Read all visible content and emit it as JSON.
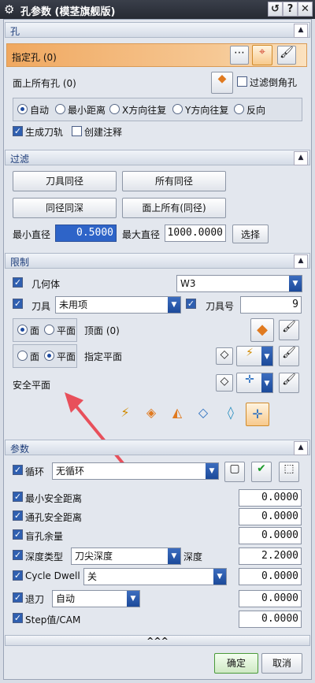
{
  "window": {
    "title": "孔参数 (模茎旗舰版)"
  },
  "sections": {
    "hole": {
      "title": "孔"
    },
    "filter": {
      "title": "过滤"
    },
    "limit": {
      "title": "限制"
    },
    "params": {
      "title": "参数"
    }
  },
  "hole": {
    "specify_hole": "指定孔 (0)",
    "all_holes_on_face": "面上所有孔 (0)",
    "filter_chamfer": "过滤倒角孔",
    "modes": [
      "自动",
      "最小距离",
      "X方向往复",
      "Y方向往复",
      "反向"
    ],
    "generate_toolpath": "生成刀轨",
    "create_annotation": "创建注释"
  },
  "filter": {
    "buttons": [
      "刀具同径",
      "所有同径",
      "同径同深",
      "面上所有(同径)"
    ],
    "min_dia_label": "最小直径",
    "min_dia_value": "0.5000",
    "max_dia_label": "最大直径",
    "max_dia_value": "1000.0000",
    "select_button": "选择"
  },
  "limit": {
    "geometry_label": "几何体",
    "geometry_value": "W3",
    "tool_label": "刀具",
    "tool_value": "未用项",
    "tool_no_label": "刀具号",
    "tool_no_value": "9",
    "top_face_label": "顶面 (0)",
    "specify_plane_label": "指定平面",
    "safe_plane_label": "安全平面",
    "face_opt": "面",
    "plane_opt": "平面"
  },
  "params": {
    "cycle_label": "循环",
    "cycle_value": "无循环",
    "rows": [
      {
        "label": "最小安全距离",
        "value": "0.0000"
      },
      {
        "label": "通孔安全距离",
        "value": "0.0000"
      },
      {
        "label": "盲孔余量",
        "value": "0.0000"
      }
    ],
    "depth_type_label": "深度类型",
    "depth_type_value": "刀尖深度",
    "depth_label": "深度",
    "depth_value": "2.2000",
    "cycle_dwell_label": "Cycle Dwell",
    "cycle_dwell_value": "关",
    "cycle_dwell_num": "0.0000",
    "retract_label": "退刀",
    "retract_value": "自动",
    "retract_num": "0.0000",
    "step_label": "Step值/CAM",
    "step_value": "0.0000"
  },
  "footer": {
    "ok": "确定",
    "cancel": "取消",
    "more": "^^^"
  },
  "colors": {
    "accent_orange": "#f0a860",
    "title_bg": "#2a2e38",
    "section_text": "#1d3d7a",
    "annotation_arrow": "#e8505b"
  }
}
